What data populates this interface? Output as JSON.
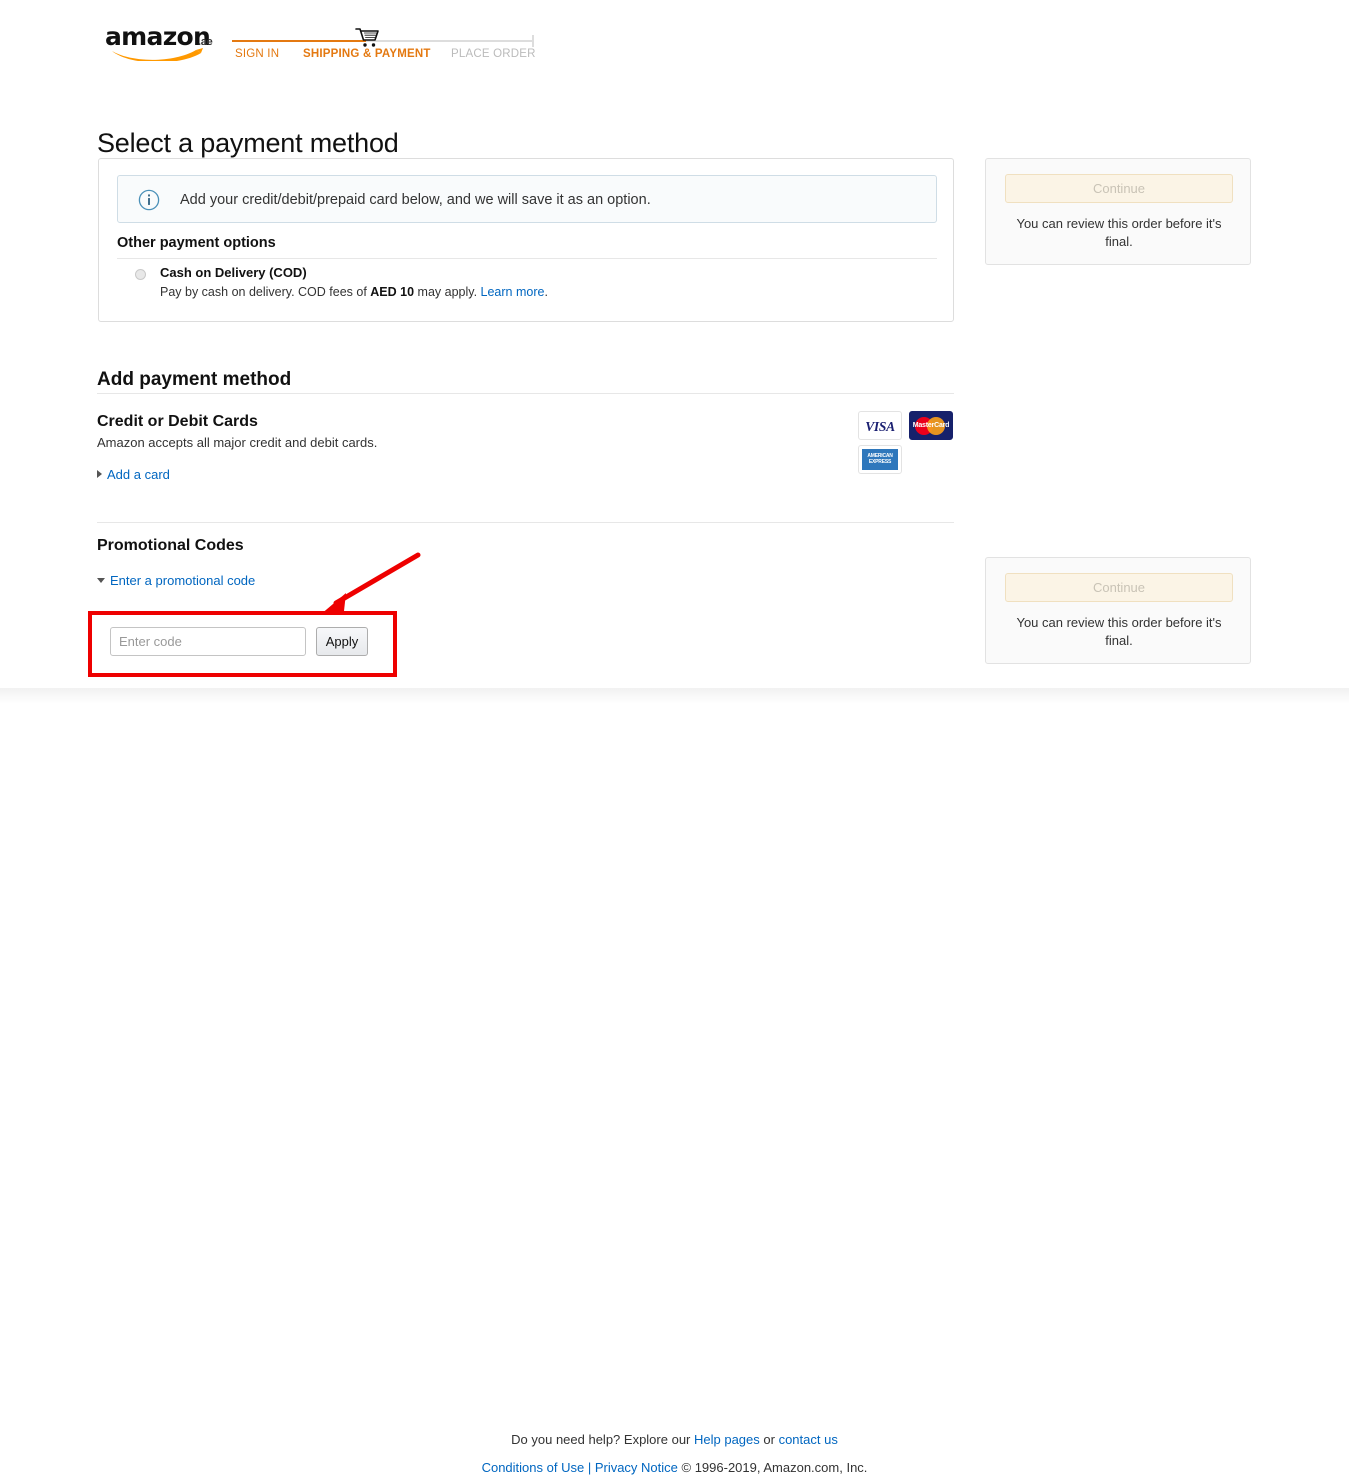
{
  "header": {
    "logo_word": "amazon",
    "logo_tld": ".ae",
    "logo_alt": "amazon-logo",
    "tracker": {
      "steps": [
        {
          "label": "SIGN IN",
          "state": "completed"
        },
        {
          "label": "SHIPPING & PAYMENT",
          "state": "current"
        },
        {
          "label": "PLACE ORDER",
          "state": "upcoming"
        }
      ],
      "current_icon": "shopping-cart-icon",
      "accent_color": "#e47911",
      "inactive_color": "#bbbbbb"
    }
  },
  "page": {
    "title": "Select a payment method"
  },
  "payment_panel": {
    "info_icon": "info-circle-icon",
    "info_text": "Add your credit/debit/prepaid card below, and we will save it as an option.",
    "other_options_heading": "Other payment options",
    "options": [
      {
        "id": "cod",
        "selected": false,
        "title": "Cash on Delivery (COD)",
        "description_pre": "Pay by cash on delivery. COD fees of ",
        "description_bold": "AED 10",
        "description_post": " may apply. ",
        "link_label": "Learn more",
        "description_end": "."
      }
    ]
  },
  "add_payment": {
    "heading": "Add payment method",
    "cards_heading": "Credit or Debit Cards",
    "cards_subtext": "Amazon accepts all major credit and debit cards.",
    "add_card_link": "Add a card",
    "accepted_cards": [
      {
        "name": "visa-card-logo",
        "label": "VISA"
      },
      {
        "name": "mastercard-card-logo",
        "label": "MasterCard"
      },
      {
        "name": "amex-card-logo",
        "label": "AMERICAN EXPRESS"
      }
    ]
  },
  "promotional": {
    "heading": "Promotional Codes",
    "toggle_label": "Enter a promotional code",
    "toggle_state": "expanded",
    "input_placeholder": "Enter code",
    "input_value": "",
    "apply_label": "Apply"
  },
  "sidebar": {
    "boxes": [
      {
        "button_label": "Continue",
        "button_disabled": true,
        "note": "You can review this order before it's final."
      },
      {
        "button_label": "Continue",
        "button_disabled": true,
        "note": "You can review this order before it's final."
      }
    ]
  },
  "footer": {
    "help_pre": "Do you need help? Explore our ",
    "help_link": "Help pages",
    "help_mid": " or ",
    "contact_link": "contact us",
    "conditions_link": "Conditions of Use",
    "pipe": " | ",
    "privacy_link": "Privacy Notice",
    "copyright": " © 1996-2019, Amazon.com, Inc."
  },
  "annotation": {
    "highlight_color": "#ee0000",
    "target": "promotional-code-entry-row",
    "arrow": "red-arrow-pointing-to-promo-input"
  }
}
